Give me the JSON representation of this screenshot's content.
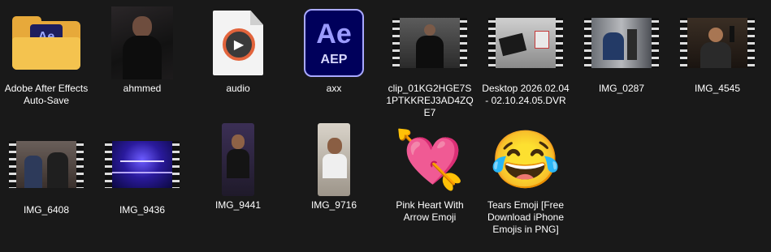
{
  "items": [
    {
      "label": "Adobe After Effects Auto-Save",
      "icon": "folder-icon"
    },
    {
      "label": "ahmmed",
      "icon": "image-thumbnail-icon"
    },
    {
      "label": "audio",
      "icon": "audio-file-icon"
    },
    {
      "label": "axx",
      "icon": "ae-project-icon",
      "icon_text": "Ae",
      "icon_subtext": "AEP"
    },
    {
      "label": "clip_01KG2HGE7S1PTKKREJ3AD4ZQE7",
      "icon": "video-thumbnail-icon"
    },
    {
      "label": "Desktop 2026.02.04 - 02.10.24.05.DVR",
      "icon": "video-thumbnail-icon"
    },
    {
      "label": "IMG_0287",
      "icon": "video-thumbnail-icon"
    },
    {
      "label": "IMG_4545",
      "icon": "video-thumbnail-icon"
    },
    {
      "label": "IMG_6408",
      "icon": "video-thumbnail-icon"
    },
    {
      "label": "IMG_9436",
      "icon": "video-thumbnail-icon"
    },
    {
      "label": "IMG_9441",
      "icon": "video-thumbnail-icon"
    },
    {
      "label": "IMG_9716",
      "icon": "video-thumbnail-icon"
    },
    {
      "label": "Pink Heart With Arrow Emoji",
      "icon": "heart-arrow-emoji-icon",
      "glyph": "💘"
    },
    {
      "label": "Tears Emoji [Free Download iPhone Emojis in PNG]",
      "icon": "tears-emoji-icon",
      "glyph": "😂"
    }
  ],
  "colors": {
    "background": "#191919",
    "text": "#ffffff",
    "folder": "#f4c34f",
    "ae_dark": "#00005b",
    "ae_light": "#9b9bff"
  }
}
